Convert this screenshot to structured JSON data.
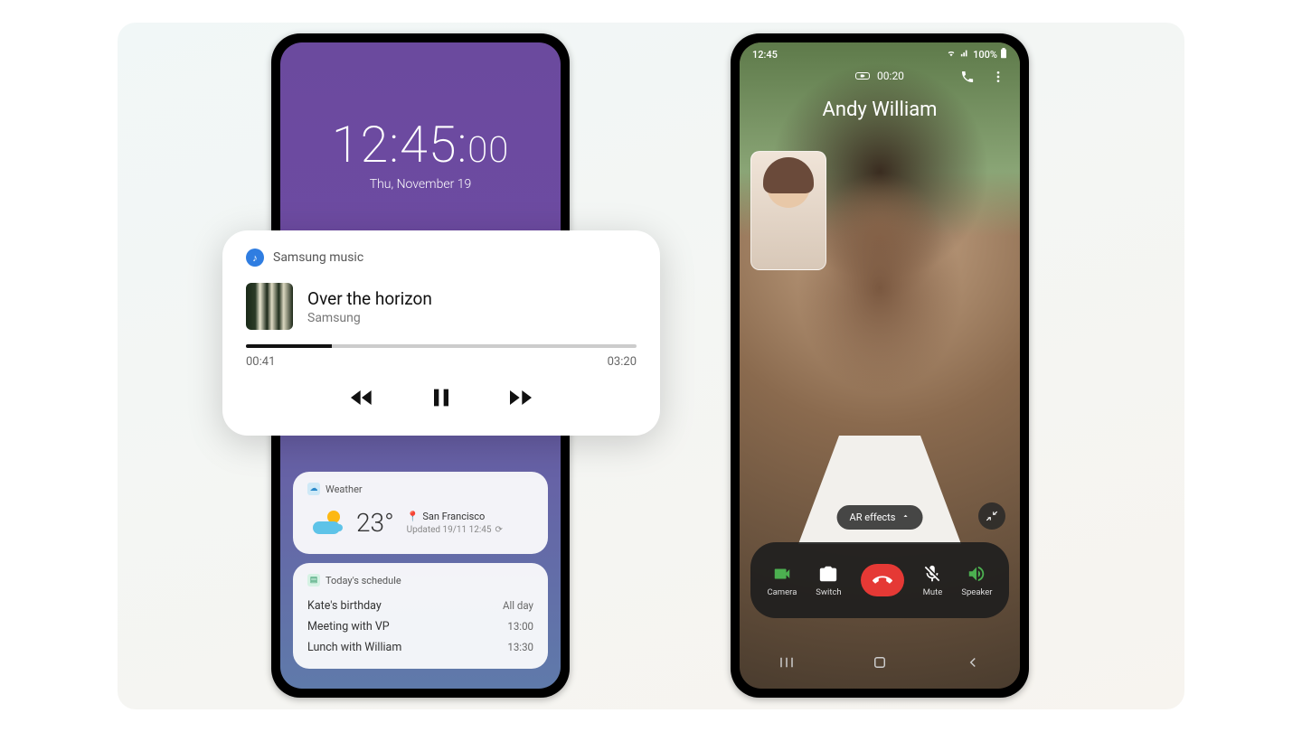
{
  "left_phone": {
    "lock": {
      "time_main": "12:45:",
      "time_sec": "00",
      "date": "Thu, November 19"
    },
    "weather": {
      "header": "Weather",
      "temp": "23°",
      "location": "San Francisco",
      "updated": "Updated 19/11 12:45"
    },
    "schedule": {
      "header": "Today's schedule",
      "rows": [
        {
          "title": "Kate's birthday",
          "time": "All day"
        },
        {
          "title": "Meeting with VP",
          "time": "13:00"
        },
        {
          "title": "Lunch with William",
          "time": "13:30"
        }
      ]
    }
  },
  "music": {
    "app": "Samsung music",
    "track": "Over the horizon",
    "artist": "Samsung",
    "elapsed": "00:41",
    "total": "03:20"
  },
  "right_phone": {
    "status": {
      "time": "12:45",
      "battery": "100%"
    },
    "call": {
      "duration": "00:20",
      "name": "Andy William",
      "ar": "AR effects",
      "buttons": {
        "camera": "Camera",
        "switch": "Switch",
        "mute": "Mute",
        "speaker": "Speaker"
      }
    }
  }
}
